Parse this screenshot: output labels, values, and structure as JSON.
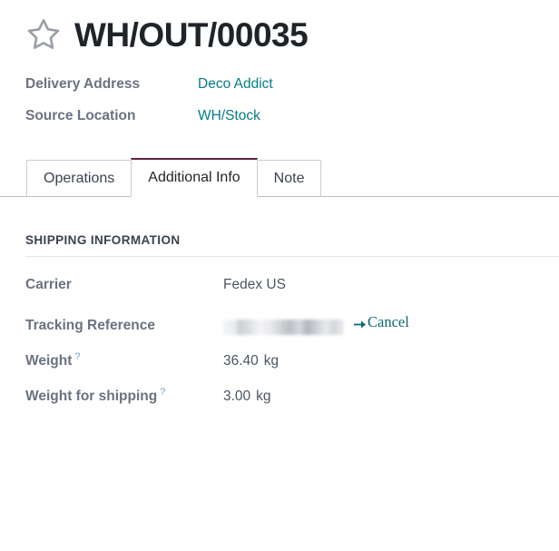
{
  "header": {
    "favorite_icon": "star-outline-icon",
    "title": "WH/OUT/00035",
    "fields": [
      {
        "label": "Delivery Address",
        "value": "Deco Addict",
        "is_link": true
      },
      {
        "label": "Source Location",
        "value": "WH/Stock",
        "is_link": true
      }
    ]
  },
  "tabs": [
    {
      "label": "Operations",
      "active": false
    },
    {
      "label": "Additional Info",
      "active": true
    },
    {
      "label": "Note",
      "active": false
    }
  ],
  "section": {
    "title": "SHIPPING INFORMATION",
    "fields": {
      "carrier": {
        "label": "Carrier",
        "value": "Fedex US"
      },
      "tracking_reference": {
        "label": "Tracking Reference",
        "value": "",
        "redacted": true,
        "cancel_label": "Cancel",
        "cancel_icon": "arrow-right-icon"
      },
      "weight": {
        "label": "Weight",
        "help_marker": "?",
        "value": "36.40",
        "unit": "kg"
      },
      "weight_for_shipping": {
        "label": "Weight for shipping",
        "help_marker": "?",
        "value": "3.00",
        "unit": "kg"
      }
    }
  },
  "colors": {
    "link": "#017e84",
    "accent_tab": "#5c2340",
    "cancel": "#0d6a72",
    "label": "#6b7280",
    "title": "#1f2429"
  }
}
